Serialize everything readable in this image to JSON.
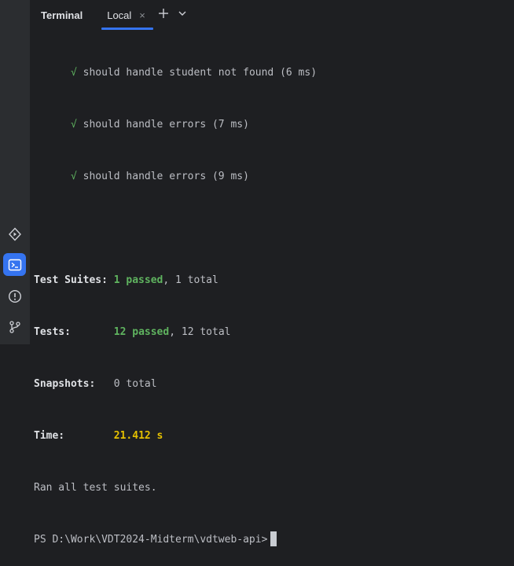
{
  "header": {
    "title": "Terminal",
    "tab": {
      "label": "Local",
      "close_glyph": "×"
    },
    "actions": {
      "new_tab_icon": "plus-icon",
      "dropdown_icon": "chevron-down-icon"
    }
  },
  "sidebar": {
    "items": [
      {
        "icon": "services-icon",
        "active": false
      },
      {
        "icon": "terminal-icon",
        "active": true
      },
      {
        "icon": "problems-icon",
        "active": false
      },
      {
        "icon": "git-icon",
        "active": false
      }
    ]
  },
  "terminal": {
    "test_lines": [
      {
        "mark": "√",
        "text": "should handle student not found (6 ms)"
      },
      {
        "mark": "√",
        "text": "should handle errors (7 ms)"
      },
      {
        "mark": "√",
        "text": "should handle errors (9 ms)"
      }
    ],
    "summary": {
      "suites_label": "Test Suites:",
      "suites_passed": "1 passed",
      "suites_total": ", 1 total",
      "tests_label": "Tests:",
      "tests_passed": "12 passed",
      "tests_total": ", 12 total",
      "snapshots_label": "Snapshots:",
      "snapshots_value": "0 total",
      "time_label": "Time:",
      "time_value": "21.412 s",
      "ran_all": "Ran all test suites."
    },
    "prompt": "PS D:\\Work\\VDT2024-Midterm\\vdtweb-api>"
  },
  "colors": {
    "accent": "#3574f0",
    "pass": "#5fb35f",
    "time": "#e5c000",
    "background": "#1e1f22"
  }
}
